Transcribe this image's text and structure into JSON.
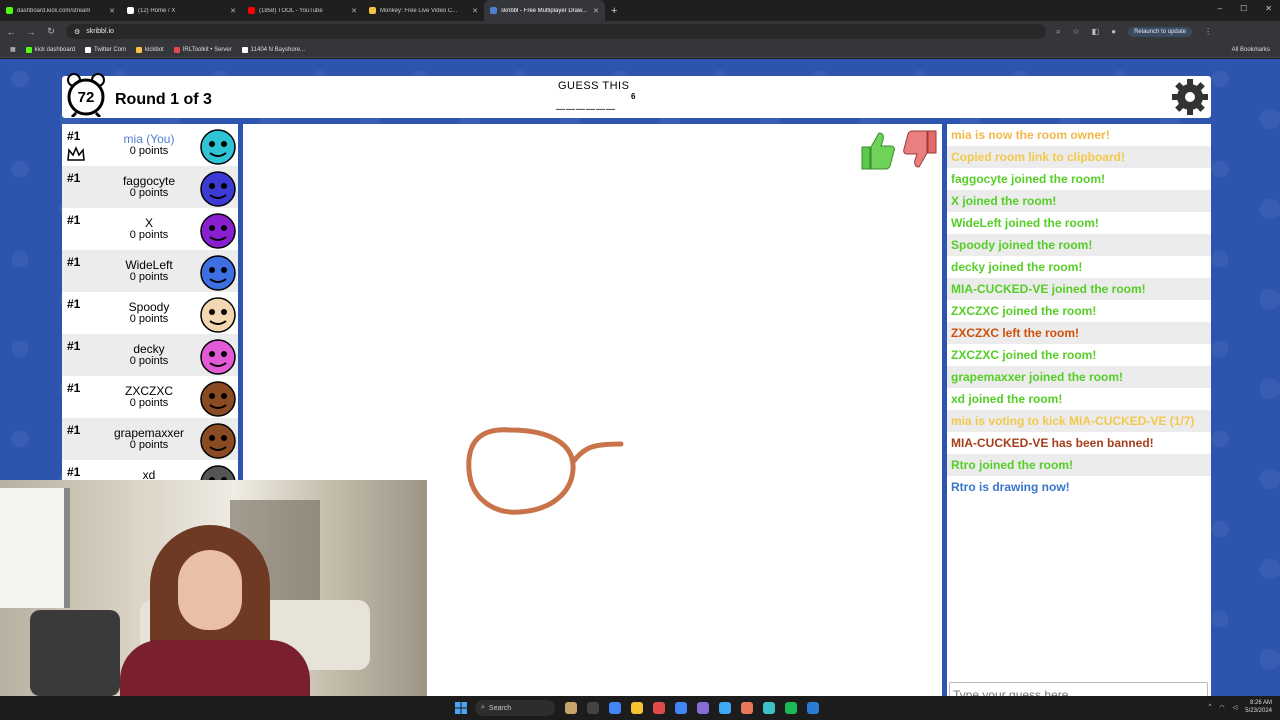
{
  "browser": {
    "tabs": [
      {
        "label": "dashboard.kick.com/stream",
        "color": "#53fc18",
        "active": false
      },
      {
        "label": "(12) Home / X",
        "color": "#ffffff",
        "active": false
      },
      {
        "label": "(1858) TOOL - YouTube",
        "color": "#ff0000",
        "active": false
      },
      {
        "label": "Monkey: Free Live Video C...",
        "color": "#f6c342",
        "active": false
      },
      {
        "label": "skribbl - Free Multiplayer Draw...",
        "color": "#4f7fd0",
        "active": true
      }
    ],
    "url": "skribbl.io",
    "relaunch_label": "Relaunch to update",
    "bookmarks": [
      {
        "label": "kick dashboard",
        "color": "#53fc18"
      },
      {
        "label": "Twitter Com",
        "color": "#ffffff"
      },
      {
        "label": "kickbot",
        "color": "#f6c342"
      },
      {
        "label": "IRLToolkit • Server",
        "color": "#e04a4a"
      },
      {
        "label": "11404 N Bayshore...",
        "color": "#ffffff"
      }
    ],
    "all_bookmarks_label": "All Bookmarks"
  },
  "game": {
    "timer": "72",
    "round_label": "Round 1 of 3",
    "guess_label": "GUESS THIS",
    "word_blanks": "______",
    "word_length": "6",
    "players": [
      {
        "rank": "#1",
        "name": "mia (You)",
        "points": "0 points",
        "avatar_color": "#2ec4d6",
        "you": true,
        "owner": true
      },
      {
        "rank": "#1",
        "name": "faggocyte",
        "points": "0 points",
        "avatar_color": "#3b3bd4"
      },
      {
        "rank": "#1",
        "name": "X",
        "points": "0 points",
        "avatar_color": "#8a1fd1"
      },
      {
        "rank": "#1",
        "name": "WideLeft",
        "points": "0 points",
        "avatar_color": "#3d6fe0"
      },
      {
        "rank": "#1",
        "name": "Spoody",
        "points": "0 points",
        "avatar_color": "#f2d7b0"
      },
      {
        "rank": "#1",
        "name": "decky",
        "points": "0 points",
        "avatar_color": "#e25ad6"
      },
      {
        "rank": "#1",
        "name": "ZXCZXC",
        "points": "0 points",
        "avatar_color": "#8a4a22"
      },
      {
        "rank": "#1",
        "name": "grapemaxxer",
        "points": "0 points",
        "avatar_color": "#8a4a22"
      },
      {
        "rank": "#1",
        "name": "xd",
        "points": "",
        "avatar_color": "#555555"
      }
    ],
    "chat": [
      {
        "text": "mia is now the room owner!",
        "color": "#f2b84b"
      },
      {
        "text": "Copied room link to clipboard!",
        "color": "#f2c94c"
      },
      {
        "text": "faggocyte joined the room!",
        "color": "#56ce27"
      },
      {
        "text": "X joined the room!",
        "color": "#56ce27"
      },
      {
        "text": "WideLeft joined the room!",
        "color": "#56ce27"
      },
      {
        "text": "Spoody joined the room!",
        "color": "#56ce27"
      },
      {
        "text": "decky joined the room!",
        "color": "#56ce27"
      },
      {
        "text": "MIA-CUCKED-VE joined the room!",
        "color": "#56ce27"
      },
      {
        "text": "ZXCZXC joined the room!",
        "color": "#56ce27"
      },
      {
        "text": "ZXCZXC left the room!",
        "color": "#ce4f0a"
      },
      {
        "text": "ZXCZXC joined the room!",
        "color": "#56ce27"
      },
      {
        "text": "grapemaxxer joined the room!",
        "color": "#56ce27"
      },
      {
        "text": "xd joined the room!",
        "color": "#56ce27"
      },
      {
        "text": "mia is voting to kick MIA-CUCKED-VE (1/7)",
        "color": "#f2c94c"
      },
      {
        "text": "MIA-CUCKED-VE has been banned!",
        "color": "#a33f1a"
      },
      {
        "text": "Rtro joined the room!",
        "color": "#56ce27"
      },
      {
        "text": "Rtro is drawing now!",
        "color": "#3975ce"
      }
    ],
    "guess_placeholder": "Type your guess here..."
  },
  "taskbar": {
    "search_label": "Search",
    "time": "8:26 AM",
    "date": "5/23/2024"
  }
}
